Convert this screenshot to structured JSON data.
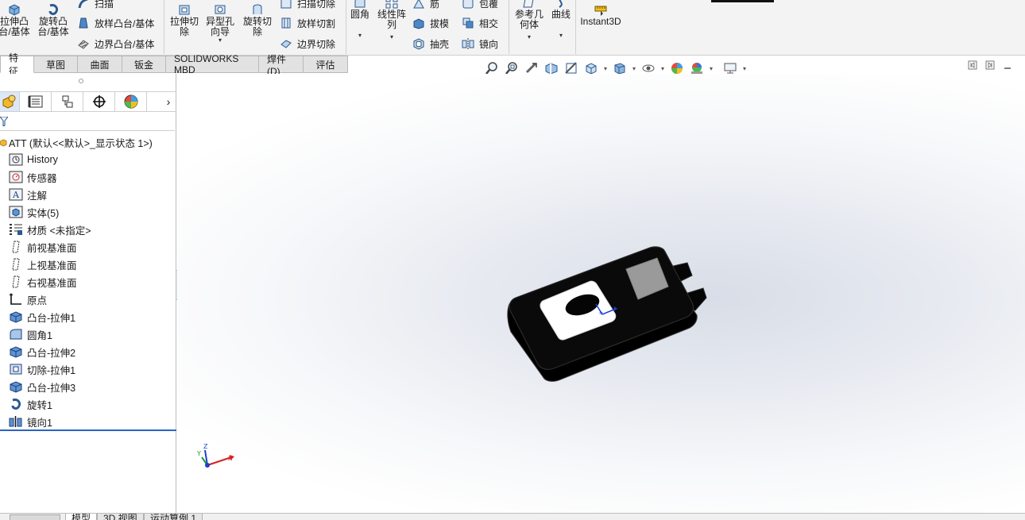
{
  "ribbon": {
    "extrude_boss": "拉伸凸\n台/基体",
    "revolve_boss": "旋转凸\n台/基体",
    "sweep": "扫描",
    "loft_boss": "放样凸台/基体",
    "boundary_boss": "边界凸台/基体",
    "extrude_cut": "拉伸切\n除",
    "hole_wizard": "异型孔\n向导",
    "revolve_cut": "旋转切\n除",
    "swept_cut": "扫描切除",
    "lofted_cut": "放样切割",
    "boundary_cut": "边界切除",
    "fillet": "圆角",
    "linear_pattern": "线性阵\n列",
    "rib": "筋",
    "draft": "拔模",
    "shell": "抽壳",
    "wrap": "包覆",
    "intersect": "相交",
    "mirror": "镜向",
    "ref_geometry": "参考几\n何体",
    "curves": "曲线",
    "instant3d": "Instant3D"
  },
  "tabs": [
    "特征",
    "草图",
    "曲面",
    "钣金",
    "SOLIDWORKS MBD",
    "焊件(D)",
    "评估"
  ],
  "active_tab": "特征",
  "tree": {
    "root": "ATT  (默认<<默认>_显示状态 1>)",
    "items": [
      {
        "label": "History",
        "icon": "history-icon"
      },
      {
        "label": "传感器",
        "icon": "sensor-icon"
      },
      {
        "label": "注解",
        "icon": "annotation-icon"
      },
      {
        "label": "实体(5)",
        "icon": "solid-bodies-icon"
      },
      {
        "label": "材质 <未指定>",
        "icon": "material-icon"
      },
      {
        "label": "前视基准面",
        "icon": "plane-icon"
      },
      {
        "label": "上视基准面",
        "icon": "plane-icon"
      },
      {
        "label": "右视基准面",
        "icon": "plane-icon"
      },
      {
        "label": "原点",
        "icon": "origin-icon"
      },
      {
        "label": "凸台-拉伸1",
        "icon": "boss-extrude-icon"
      },
      {
        "label": "圆角1",
        "icon": "fillet-icon"
      },
      {
        "label": "凸台-拉伸2",
        "icon": "boss-extrude-icon"
      },
      {
        "label": "切除-拉伸1",
        "icon": "cut-extrude-icon"
      },
      {
        "label": "凸台-拉伸3",
        "icon": "boss-extrude-icon"
      },
      {
        "label": "旋转1",
        "icon": "revolve-icon"
      },
      {
        "label": "镜向1",
        "icon": "mirror-icon"
      }
    ]
  },
  "triad": {
    "x": "X",
    "y": "Y",
    "z": "Z"
  },
  "bottom_tabs": [
    "模型",
    "3D 视图",
    "运动算例 1"
  ],
  "active_bottom_tab": "模型",
  "colors": {
    "accent": "#2b63c4",
    "model_body": "#0a0a0a",
    "model_plate": "#ffffff",
    "model_screen": "#9a9a9a",
    "axis_x": "#d42020",
    "axis_y": "#1f9a2a",
    "axis_z": "#1b3fd1"
  }
}
